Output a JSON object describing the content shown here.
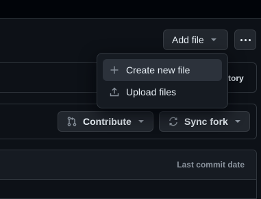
{
  "toolbar": {
    "add_file_label": "Add file",
    "more_icon": "kebab-horizontal-icon"
  },
  "add_file_menu": {
    "items": [
      {
        "label": "Create new file",
        "icon": "plus-icon",
        "highlighted": true
      },
      {
        "label": "Upload files",
        "icon": "upload-icon",
        "highlighted": false
      }
    ]
  },
  "history_link_fragment": "tory",
  "fork_actions": {
    "contribute_label": "Contribute",
    "contribute_icon": "git-pull-request-icon",
    "sync_fork_label": "Sync fork",
    "sync_fork_icon": "sync-icon"
  },
  "file_table": {
    "last_commit_date_header": "Last commit date"
  },
  "colors": {
    "background": "#0d1117",
    "button_bg": "#21262d",
    "border": "#30363d",
    "menu_highlight": "#2c323b",
    "muted_text": "#8b949e"
  }
}
